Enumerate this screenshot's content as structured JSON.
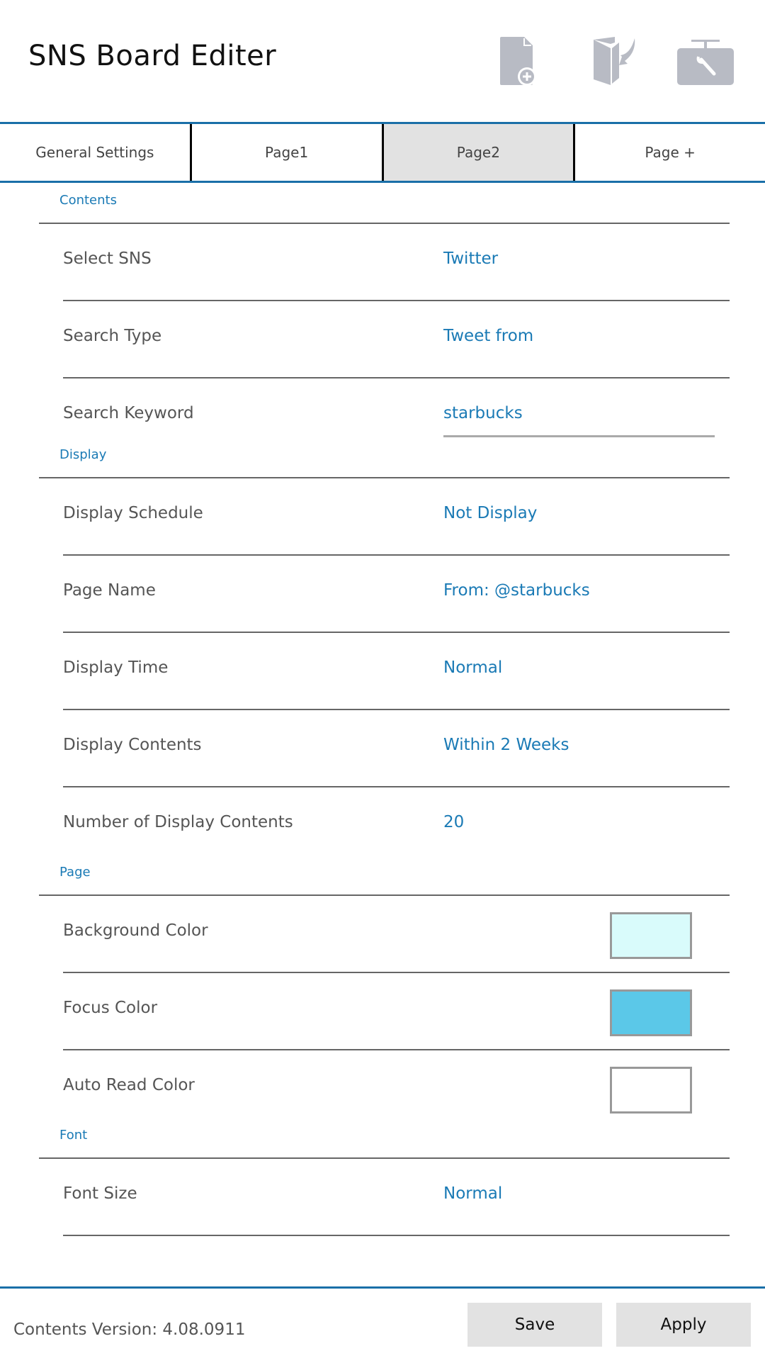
{
  "app": {
    "title": "SNS Board Editer"
  },
  "toolbar": {
    "icons": [
      {
        "name": "new-page-icon"
      },
      {
        "name": "open-book-icon"
      },
      {
        "name": "toolbox-wrench-icon"
      }
    ],
    "icon_color": "#b8bbc4"
  },
  "tabs": [
    {
      "label": "General Settings",
      "active": false
    },
    {
      "label": "Page1",
      "active": false
    },
    {
      "label": "Page2",
      "active": true
    },
    {
      "label": "Page +",
      "active": false
    }
  ],
  "sections": {
    "contents": {
      "title": "Contents",
      "select_sns": {
        "label": "Select SNS",
        "value": "Twitter"
      },
      "search_type": {
        "label": "Search Type",
        "value": "Tweet from"
      },
      "search_keyword": {
        "label": "Search Keyword",
        "value": "starbucks"
      }
    },
    "display": {
      "title": "Display",
      "display_schedule": {
        "label": "Display Schedule",
        "value": "Not Display"
      },
      "page_name": {
        "label": "Page Name",
        "value": "From: @starbucks"
      },
      "display_time": {
        "label": "Display Time",
        "value": "Normal"
      },
      "display_contents": {
        "label": "Display Contents",
        "value": "Within 2 Weeks"
      },
      "number_of_display_contents": {
        "label": "Number of Display Contents",
        "value": "20"
      }
    },
    "page": {
      "title": "Page",
      "background_color": {
        "label": "Background Color",
        "color": "#d9fbfb"
      },
      "focus_color": {
        "label": "Focus Color",
        "color": "#5bc8e8"
      },
      "auto_read_color": {
        "label": "Auto Read Color",
        "color": "#ffffff"
      }
    },
    "font": {
      "title": "Font",
      "font_size": {
        "label": "Font Size",
        "value": "Normal"
      }
    }
  },
  "footer": {
    "version": "Contents Version: 4.08.0911",
    "save_label": "Save",
    "apply_label": "Apply"
  },
  "colors": {
    "accent": "#1a7ab5",
    "tab_border": "#1a6fa8",
    "active_tab_bg": "#e2e2e2"
  }
}
